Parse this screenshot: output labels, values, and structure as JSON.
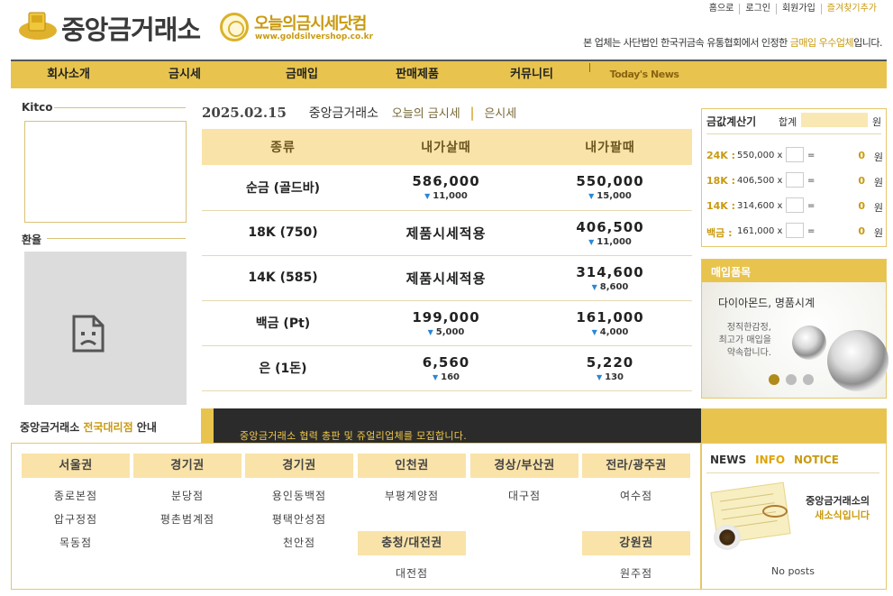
{
  "header": {
    "logo_text": "중앙금거래소",
    "shop_name": "오늘의금시세닷컴",
    "shop_url": "www.goldsilvershop.co.kr",
    "top_links": [
      "홈으로",
      "로그인",
      "회원가입",
      "즐겨찾기추가"
    ],
    "cert_prefix": "본 업체는 사단법인 한국귀금속 유통협회에서 인정한 ",
    "cert_highlight": "금매입 우수업체",
    "cert_suffix": "입니다."
  },
  "nav": [
    "회사소개",
    "금시세",
    "금매입",
    "판매제품",
    "커뮤니티",
    "Today's News"
  ],
  "left": {
    "kitco_title": "Kitco",
    "fx_title": "환율",
    "agency_prefix": "중앙금거래소 ",
    "agency_highlight": "전국대리점",
    "agency_suffix": " 안내"
  },
  "prices": {
    "date": "2025.02.15",
    "company": "중앙금거래소",
    "link1": "오늘의 금시세",
    "link2": "은시세",
    "headers": [
      "종류",
      "내가살때",
      "내가팔때"
    ],
    "rows": [
      {
        "name": "순금 (골드바)",
        "buy": "586,000",
        "buy_chg": "11,000",
        "sell": "550,000",
        "sell_chg": "15,000"
      },
      {
        "name": "18K (750)",
        "buy": "제품시세적용",
        "buy_chg": "",
        "sell": "406,500",
        "sell_chg": "11,000"
      },
      {
        "name": "14K (585)",
        "buy": "제품시세적용",
        "buy_chg": "",
        "sell": "314,600",
        "sell_chg": "8,600"
      },
      {
        "name": "백금 (Pt)",
        "buy": "199,000",
        "buy_chg": "5,000",
        "sell": "161,000",
        "sell_chg": "4,000"
      },
      {
        "name": "은 (1돈)",
        "buy": "6,560",
        "buy_chg": "160",
        "sell": "5,220",
        "sell_chg": "130"
      }
    ]
  },
  "calculator": {
    "title": "금값계산기",
    "total_label": "합계",
    "won": "원",
    "rows": [
      {
        "k": "24K :",
        "p": "550,000 x",
        "eq": "=",
        "z": "0",
        "w": "원"
      },
      {
        "k": "18K :",
        "p": "406,500 x",
        "eq": "=",
        "z": "0",
        "w": "원"
      },
      {
        "k": "14K :",
        "p": "314,600 x",
        "eq": "=",
        "z": "0",
        "w": "원"
      },
      {
        "k": "백금 :",
        "p": "161,000 x",
        "eq": "=",
        "z": "0",
        "w": "원"
      }
    ]
  },
  "buy_items": {
    "title": "매입품목",
    "headline": "다이아몬드, 명품시계",
    "desc": [
      "정직한감정,",
      "최고가 매입을",
      "약속합니다."
    ]
  },
  "banner": {
    "text": "중앙금거래소 협력 총판 및 쥬얼리업체를 모집합니다."
  },
  "branches": {
    "regions": [
      "서울권",
      "경기권",
      "경기권",
      "인천권",
      "경상/부산권",
      "전라/광주권",
      "충청/대전권",
      "강원권"
    ],
    "seoul": [
      "종로본점",
      "압구정점",
      "목동점"
    ],
    "gyeonggi1": [
      "분당점",
      "평촌범계점"
    ],
    "gyeonggi2": [
      "용인동백점",
      "평택안성점",
      "천안점"
    ],
    "incheon": [
      "부평계양점"
    ],
    "gyeongsang": [
      "대구점"
    ],
    "jeolla": [
      "여수점"
    ],
    "chungcheong": [
      "대전점"
    ],
    "gangwon": [
      "원주점"
    ]
  },
  "news": {
    "tabs": [
      "NEWS",
      "INFO",
      "NOTICE"
    ],
    "line1": "중앙금거래소의",
    "line2": "새소식입니다",
    "empty": "No posts"
  }
}
